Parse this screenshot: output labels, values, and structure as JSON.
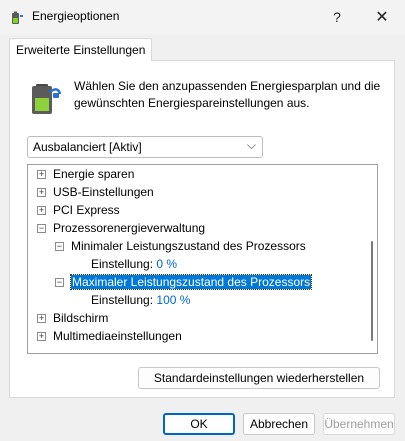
{
  "window": {
    "title": "Energieoptionen",
    "help_label": "?",
    "close_label": "✕"
  },
  "tabs": [
    {
      "label": "Erweiterte Einstellungen",
      "active": true
    }
  ],
  "description": "Wählen Sie den anzupassenden Energiesparplan und die gewünschten Energiespareinstellungen aus.",
  "plan_select": {
    "value": "Ausbalanciert [Aktiv]",
    "chevron": "⌵"
  },
  "tree": {
    "items": [
      {
        "label": "Energie sparen",
        "expanded": false
      },
      {
        "label": "USB-Einstellungen",
        "expanded": false
      },
      {
        "label": "PCI Express",
        "expanded": false
      },
      {
        "label": "Prozessorenergieverwaltung",
        "expanded": true
      },
      {
        "label": "Minimaler Leistungszustand des Prozessors",
        "expanded": true
      },
      {
        "label": "Einstellung:",
        "value": "0 %"
      },
      {
        "label": "Maximaler Leistungszustand des Prozessors",
        "expanded": true,
        "selected": true
      },
      {
        "label": "Einstellung:",
        "value": "100 %"
      },
      {
        "label": "Bildschirm",
        "expanded": false
      },
      {
        "label": "Multimediaeinstellungen",
        "expanded": false
      }
    ]
  },
  "buttons": {
    "restore_defaults": "Standardeinstellungen wiederherstellen",
    "ok": "OK",
    "cancel": "Abbrechen",
    "apply": "Übernehmen"
  },
  "colors": {
    "selection": "#0078d7",
    "link": "#0066cc",
    "ok_border": "#0067c0"
  }
}
